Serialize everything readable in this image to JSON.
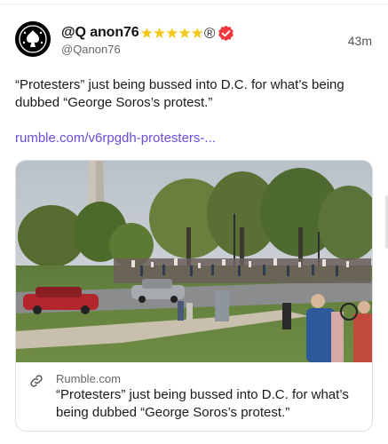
{
  "post": {
    "display_name": "@Q anon76",
    "star_icons": [
      "star-icon",
      "star-icon",
      "star-icon",
      "star-icon",
      "star-icon"
    ],
    "registered_mark": "®",
    "handle": "@Qanon76",
    "timestamp": "43m",
    "text": "“Protesters” just being bussed into D.C. for what’s being dubbed “George Soros’s protest.”",
    "link_text": "rumble.com/v6rpgdh-protesters-...",
    "accent_color": "#6a4cd9",
    "verified_color": "#f2363d",
    "star_color": "#f5c518"
  },
  "card": {
    "image_icon": "protest-photo",
    "link_icon": "link-icon",
    "domain": "Rumble.com",
    "title": "“Protesters” just being bussed into D.C. for what’s being dubbed “George Soros’s protest.”"
  }
}
